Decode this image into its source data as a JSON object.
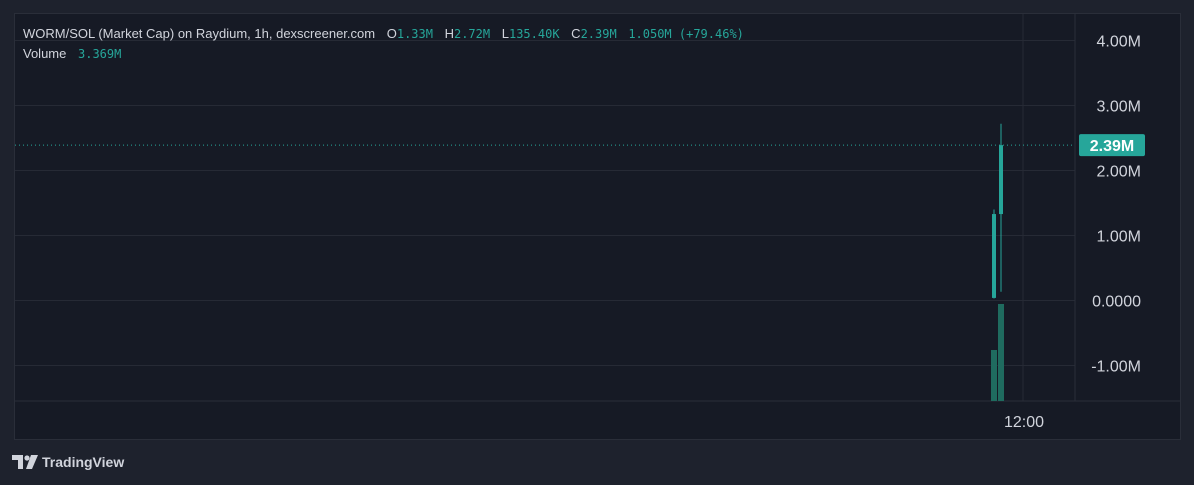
{
  "legend": {
    "title": "WORM/SOL (Market Cap) on Raydium, 1h, dexscreener.com",
    "o_label": "O",
    "o_value": "1.33M",
    "h_label": "H",
    "h_value": "2.72M",
    "l_label": "L",
    "l_value": "135.40K",
    "c_label": "C",
    "c_value": "2.39M",
    "change": "1.050M (+79.46%)",
    "volume_label": "Volume",
    "volume_value": "3.369M"
  },
  "brand": {
    "name": "TradingView"
  },
  "colors": {
    "up": "#26a69a",
    "volume": "#1f6b5f",
    "grid": "#262a35",
    "background": "#161a25",
    "text": "#d1d4dc"
  },
  "chart_data": {
    "type": "candlestick",
    "y_ticks": [
      {
        "value": 4000000,
        "label": "4.00M"
      },
      {
        "value": 3000000,
        "label": "3.00M"
      },
      {
        "value": 2000000,
        "label": "2.00M"
      },
      {
        "value": 1000000,
        "label": "1.00M"
      },
      {
        "value": 0,
        "label": "0.0000"
      },
      {
        "value": -1000000,
        "label": "-1.00M"
      }
    ],
    "ylim": [
      -1580000,
      4450000
    ],
    "x_ticks": [
      {
        "label": "12:00"
      }
    ],
    "candles": [
      {
        "open": 40000,
        "high": 1400000,
        "low": 30000,
        "close": 1330000,
        "volume": 0.55
      },
      {
        "open": 1330000,
        "high": 2720000,
        "low": 135400,
        "close": 2390000,
        "volume": 1.0
      }
    ],
    "last_price": {
      "value": 2390000,
      "label": "2.39M"
    },
    "grid": true
  }
}
